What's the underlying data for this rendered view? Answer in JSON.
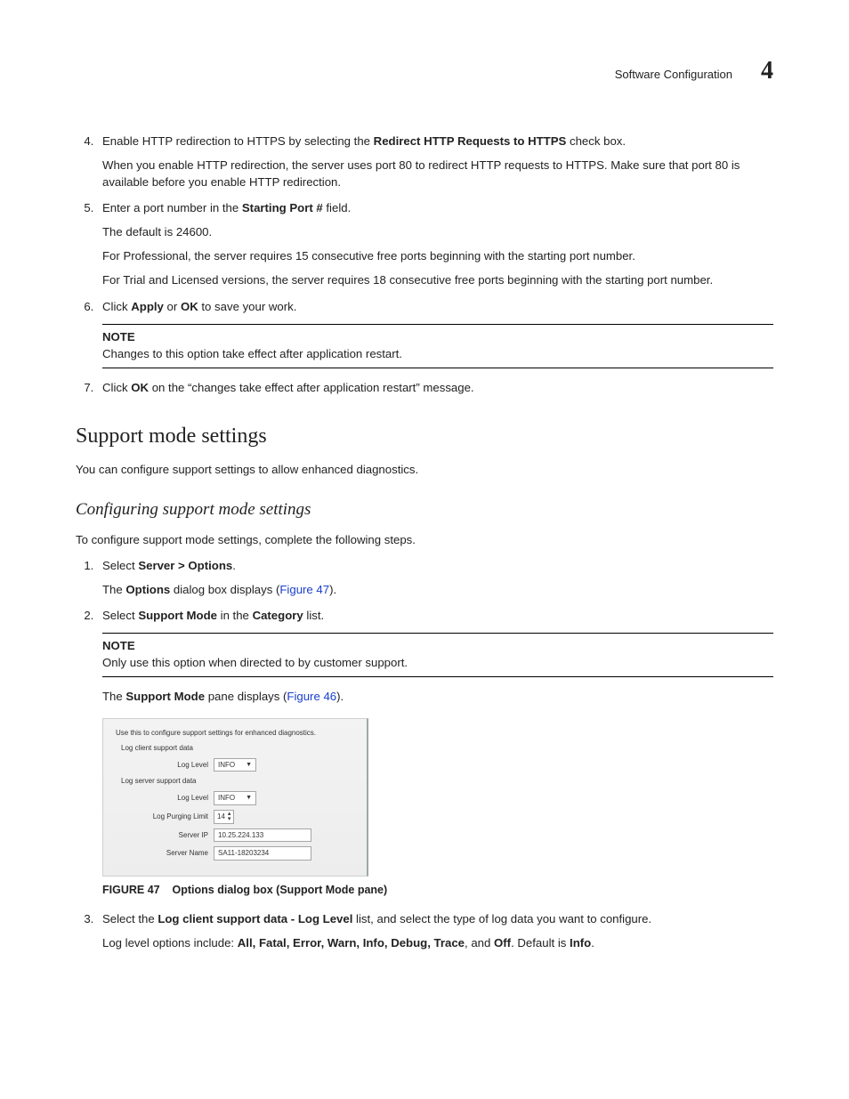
{
  "header": {
    "title": "Software Configuration",
    "chapter_number": "4"
  },
  "steps": {
    "s4": {
      "n": "4.",
      "pre": "Enable HTTP redirection to HTTPS by selecting the ",
      "bold": "Redirect HTTP Requests to HTTPS",
      "post": " check box.",
      "p2": "When you enable HTTP redirection, the server uses port 80 to redirect HTTP requests to HTTPS. Make sure that port 80 is available before you enable HTTP redirection."
    },
    "s5": {
      "n": "5.",
      "pre": "Enter a port number in the ",
      "bold": "Starting Port #",
      "post": " field.",
      "p2": "The default is 24600.",
      "p3": "For Professional, the server requires 15 consecutive free ports beginning with the starting port number.",
      "p4": "For Trial and Licensed versions, the server requires 18 consecutive free ports beginning with the starting port number."
    },
    "s6": {
      "n": "6.",
      "pre": "Click ",
      "b1": "Apply",
      "mid": " or ",
      "b2": "OK",
      "post": " to save your work.",
      "note_label": "NOTE",
      "note_body": "Changes to this option take effect after application restart."
    },
    "s7": {
      "n": "7.",
      "pre": "Click ",
      "b1": "OK",
      "post": " on the “changes take effect after application restart” message."
    }
  },
  "h2": "Support mode settings",
  "p_after_h2": "You can configure support settings to allow enhanced diagnostics.",
  "h3": "Configuring support mode settings",
  "p_after_h3": "To configure support mode settings, complete the following steps.",
  "steps2": {
    "s1": {
      "n": "1.",
      "pre": "Select ",
      "menu": "Server > Options",
      "post": ".",
      "p2a": "The ",
      "p2b": "Options",
      "p2c": " dialog box displays (",
      "p2link": "Figure 47",
      "p2d": ")."
    },
    "s2": {
      "n": "2.",
      "pre": "Select ",
      "b1": "Support Mode",
      "mid": " in the ",
      "b2": "Category",
      "post": " list.",
      "note_label": "NOTE",
      "note_body": "Only use this option when directed to by customer support.",
      "p2a": "The ",
      "p2b": "Support Mode",
      "p2c": " pane displays (",
      "p2link": "Figure 46",
      "p2d": ")."
    },
    "s3": {
      "n": "3.",
      "pre": "Select the ",
      "b1": "Log client support data - Log Level",
      "post": " list, and select the type of log data you want to configure.",
      "p2a": "Log level options include: ",
      "p2opts": "All, Fatal, Error, Warn, Info, Debug, Trace",
      "p2b": ", and ",
      "p2off": "Off",
      "p2c": ". Default is ",
      "p2def": "Info",
      "p2d": "."
    }
  },
  "dialog": {
    "heading": "Use this to configure support settings for enhanced diagnostics.",
    "client_group": "Log client support data",
    "server_group": "Log server support data",
    "lbl_log_level": "Log Level",
    "val_info": "INFO",
    "lbl_purge": "Log Purging Limit",
    "val_purge": "14",
    "lbl_server_ip": "Server IP",
    "val_server_ip": "10.25.224.133",
    "lbl_server_name": "Server Name",
    "val_server_name": "SA11-18203234"
  },
  "figure": {
    "label": "FIGURE 47",
    "caption": "Options dialog box (Support Mode pane)"
  }
}
